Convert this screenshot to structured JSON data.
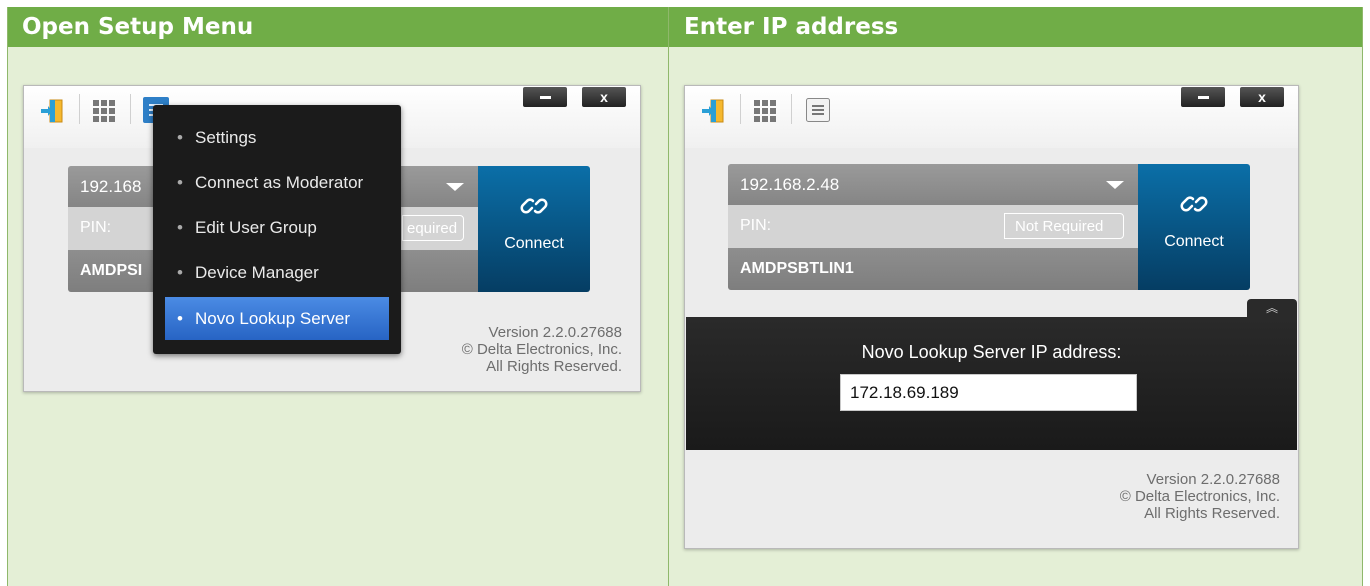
{
  "sections": {
    "left_title": "Open Setup Menu",
    "right_title": "Enter IP address"
  },
  "left_window": {
    "ip_value": "192.168",
    "pin_label": "PIN:",
    "pin_tag": "equired",
    "device_name": "AMDPSI",
    "connect_label": "Connect",
    "version_lines": [
      "Version 2.2.0.27688",
      "© Delta Electronics, Inc.",
      "All Rights Reserved."
    ],
    "window_buttons": {
      "close": "x"
    }
  },
  "setup_menu": {
    "items": [
      {
        "label": "Settings",
        "active": false
      },
      {
        "label": "Connect as Moderator",
        "active": false
      },
      {
        "label": "Edit User Group",
        "active": false
      },
      {
        "label": "Device Manager",
        "active": false
      },
      {
        "label": "Novo Lookup Server",
        "active": true
      }
    ]
  },
  "right_window": {
    "ip_value": "192.168.2.48",
    "pin_label": "PIN:",
    "pin_tag": "Not Required",
    "device_name": "AMDPSBTLIN1",
    "connect_label": "Connect",
    "lookup_label": "Novo Lookup Server IP address:",
    "lookup_value": "172.18.69.189",
    "collapse_glyph": "︽",
    "version_lines": [
      "Version 2.2.0.27688",
      "© Delta Electronics, Inc.",
      "All Rights Reserved."
    ],
    "window_buttons": {
      "close": "x"
    }
  },
  "colors": {
    "header_green": "#70ad47",
    "doc_bg": "#e4efd6",
    "connect_blue": "#0b6fa8",
    "menu_active": "#3a78d4"
  },
  "icons": [
    "projector-icon",
    "grid-icon",
    "menu-icon",
    "link-icon",
    "minimize-icon",
    "close-icon",
    "collapse-icon"
  ]
}
